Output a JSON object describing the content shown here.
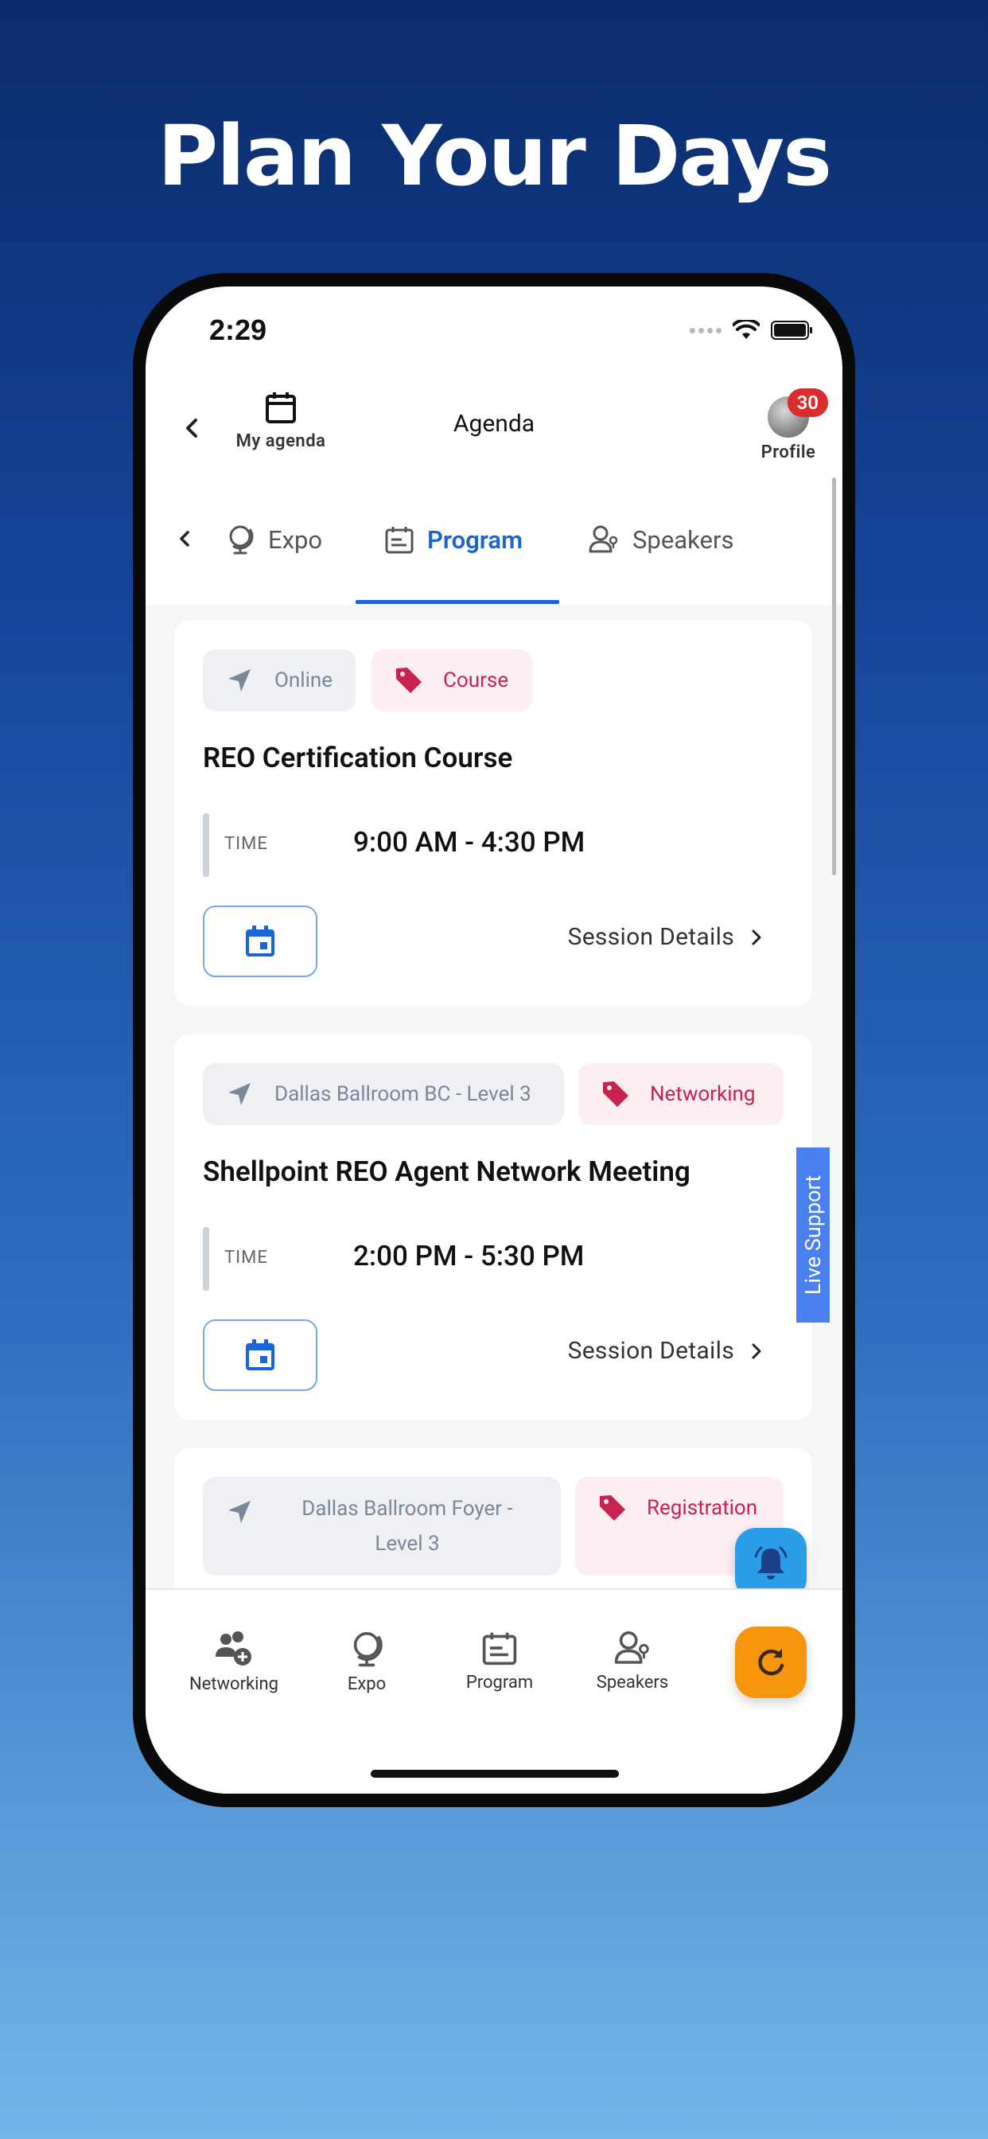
{
  "hero": {
    "title": "Plan Your Days"
  },
  "status_bar": {
    "time": "2:29"
  },
  "header": {
    "my_agenda_label": "My agenda",
    "title": "Agenda",
    "profile_label": "Profile",
    "notification_count": "30"
  },
  "tabs": [
    {
      "label": "Expo",
      "icon": "globe-icon"
    },
    {
      "label": "Program",
      "icon": "program-icon",
      "active": true
    },
    {
      "label": "Speakers",
      "icon": "speakers-icon"
    }
  ],
  "sessions": [
    {
      "location": "Online",
      "tag": "Course",
      "title": "REO Certification Course",
      "time_label": "TIME",
      "time": "9:00 AM - 4:30 PM",
      "details_label": "Session Details"
    },
    {
      "location": "Dallas Ballroom BC - Level 3",
      "tag": "Networking",
      "title": "Shellpoint REO Agent Network Meeting",
      "time_label": "TIME",
      "time": "2:00 PM - 5:30 PM",
      "details_label": "Session Details"
    },
    {
      "location_line1": "Dallas Ballroom Foyer -",
      "location_line2": "Level 3",
      "tag": "Registration"
    }
  ],
  "live_support_label": "Live Support",
  "bottom_nav": [
    {
      "label": "Networking",
      "icon": "networking-icon"
    },
    {
      "label": "Expo",
      "icon": "globe-icon"
    },
    {
      "label": "Program",
      "icon": "program-icon"
    },
    {
      "label": "Speakers",
      "icon": "speakers-icon"
    }
  ],
  "colors": {
    "accent": "#1a64d6",
    "tag_red": "#c8234e",
    "bell_fab": "#2a9de8",
    "refresh_fab": "#f7950c",
    "live_support": "#4a7ff0"
  }
}
